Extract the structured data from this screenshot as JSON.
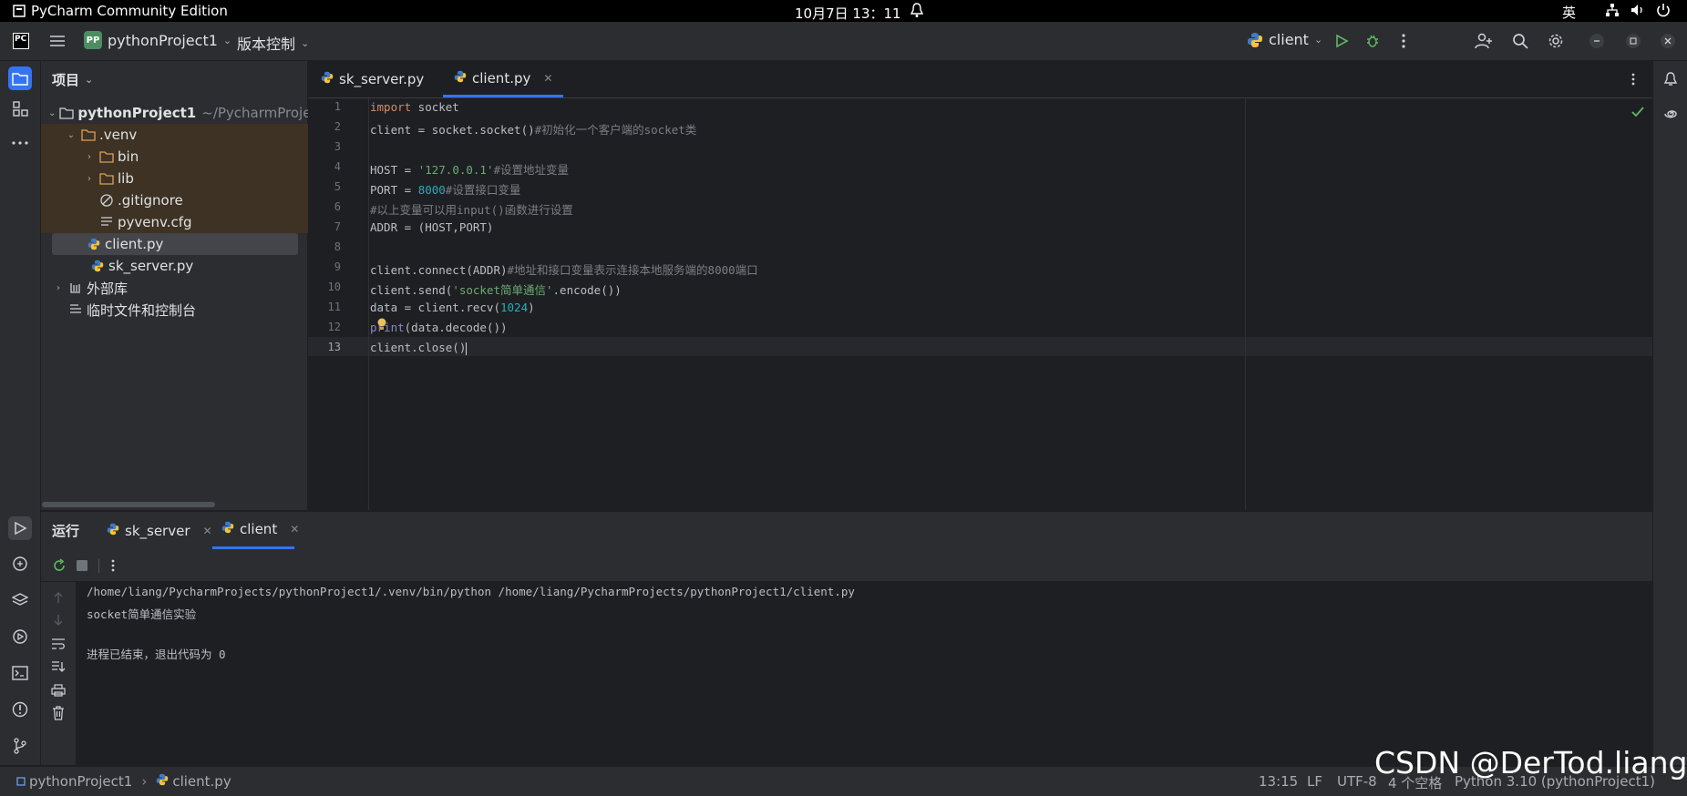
{
  "os": {
    "app_title": "PyCharm Community Edition",
    "clock": "10月7日 13：11",
    "input_method": "英"
  },
  "titlebar": {
    "project_badge": "PP",
    "project_name": "pythonProject1",
    "vcs_menu": "版本控制",
    "run_config": "client"
  },
  "project_panel": {
    "header": "项目",
    "root_name": "pythonProject1",
    "root_path": "~/PycharmProjects",
    "items": [
      {
        "label": ".venv"
      },
      {
        "label": "bin"
      },
      {
        "label": "lib"
      },
      {
        "label": ".gitignore"
      },
      {
        "label": "pyvenv.cfg"
      },
      {
        "label": "client.py"
      },
      {
        "label": "sk_server.py"
      },
      {
        "label": "外部库"
      },
      {
        "label": "临时文件和控制台"
      }
    ]
  },
  "editor": {
    "tabs": [
      {
        "label": "sk_server.py"
      },
      {
        "label": "client.py"
      }
    ],
    "line_numbers": [
      "1",
      "2",
      "3",
      "4",
      "5",
      "6",
      "7",
      "8",
      "9",
      "10",
      "11",
      "12",
      "13"
    ],
    "code": {
      "l1_kw": "import",
      "l1_rest": " socket",
      "l2_code": "client = socket.socket()",
      "l2_cm": "#初始化一个客户端的socket类",
      "l4_code": "HOST = ",
      "l4_str": "'127.0.0.1'",
      "l4_cm": "#设置地址变量",
      "l5_code": "PORT = ",
      "l5_num": "8000",
      "l5_cm": "#设置接口变量",
      "l6_cm": "#以上变量可以用input()函数进行设置",
      "l7_code": "ADDR = (HOST,PORT)",
      "l9_code": "client.connect(ADDR)",
      "l9_cm": "#地址和接口变量表示连接本地服务端的8000端口",
      "l10_a": "client.send(",
      "l10_str": "'socket简单通信'",
      "l10_b": ".encode())",
      "l11_a": "data = client.recv(",
      "l11_num": "1024",
      "l11_b": ")",
      "l12_kw": "print",
      "l12_rest": "(data.decode())",
      "l13_code": "client.close()"
    }
  },
  "run_panel": {
    "title": "运行",
    "tabs": [
      {
        "label": "sk_server"
      },
      {
        "label": "client"
      }
    ],
    "output": [
      "/home/liang/PycharmProjects/pythonProject1/.venv/bin/python /home/liang/PycharmProjects/pythonProject1/client.py",
      "socket简单通信实验",
      "",
      "进程已结束，退出代码为 0"
    ]
  },
  "statusbar": {
    "breadcrumb_project": "pythonProject1",
    "breadcrumb_file": "client.py",
    "cursor_pos": "13:15",
    "line_sep": "LF",
    "encoding": "UTF-8",
    "indent": "4 个空格",
    "interpreter": "Python 3.10 (pythonProject1)"
  },
  "watermark": "CSDN @DerTod.liang"
}
